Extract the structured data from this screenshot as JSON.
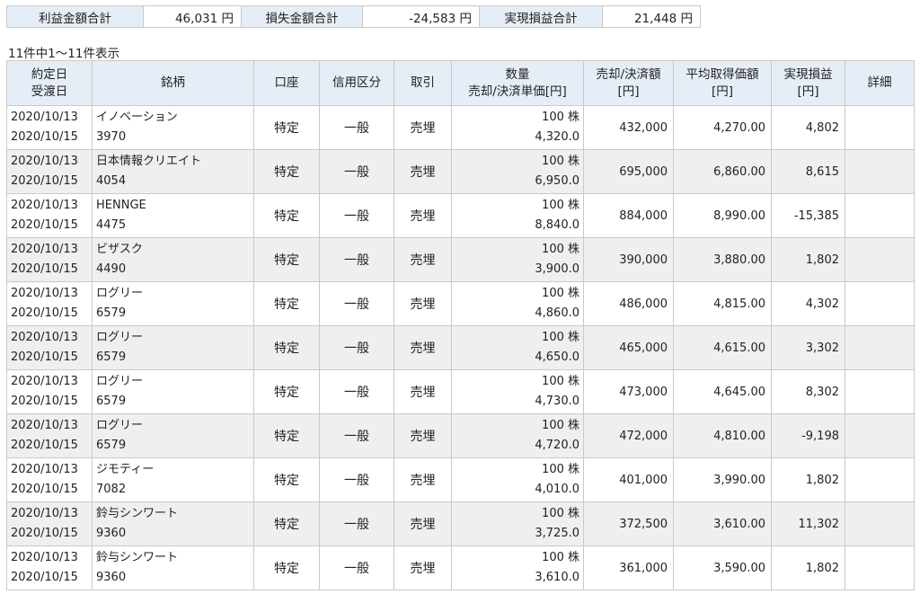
{
  "summary": {
    "profit_label": "利益金額合計",
    "profit_value": "46,031 円",
    "loss_label": "損失金額合計",
    "loss_value": "-24,583 円",
    "realized_label": "実現損益合計",
    "realized_value": "21,448 円"
  },
  "count_text": "11件中1～11件表示",
  "headers": {
    "date_1": "約定日",
    "date_2": "受渡日",
    "name": "銘柄",
    "account": "口座",
    "margin": "信用区分",
    "trade": "取引",
    "qty_1": "数量",
    "qty_2": "売却/決済単価[円]",
    "amount_1": "売却/決済額",
    "amount_2": "[円]",
    "avg_1": "平均取得価額",
    "avg_2": "[円]",
    "pl_1": "実現損益",
    "pl_2": "[円]",
    "detail": "詳細"
  },
  "rows": [
    {
      "trade_date": "2020/10/13",
      "settle_date": "2020/10/15",
      "name": "イノベーション",
      "code": "3970",
      "account": "特定",
      "margin": "一般",
      "trade": "売埋",
      "qty": "100 株",
      "unit_price": "4,320.0",
      "amount": "432,000",
      "avg_cost": "4,270.00",
      "pl": "4,802"
    },
    {
      "trade_date": "2020/10/13",
      "settle_date": "2020/10/15",
      "name": "日本情報クリエイト",
      "code": "4054",
      "account": "特定",
      "margin": "一般",
      "trade": "売埋",
      "qty": "100 株",
      "unit_price": "6,950.0",
      "amount": "695,000",
      "avg_cost": "6,860.00",
      "pl": "8,615"
    },
    {
      "trade_date": "2020/10/13",
      "settle_date": "2020/10/15",
      "name": "HENNGE",
      "code": "4475",
      "account": "特定",
      "margin": "一般",
      "trade": "売埋",
      "qty": "100 株",
      "unit_price": "8,840.0",
      "amount": "884,000",
      "avg_cost": "8,990.00",
      "pl": "-15,385"
    },
    {
      "trade_date": "2020/10/13",
      "settle_date": "2020/10/15",
      "name": "ビザスク",
      "code": "4490",
      "account": "特定",
      "margin": "一般",
      "trade": "売埋",
      "qty": "100 株",
      "unit_price": "3,900.0",
      "amount": "390,000",
      "avg_cost": "3,880.00",
      "pl": "1,802"
    },
    {
      "trade_date": "2020/10/13",
      "settle_date": "2020/10/15",
      "name": "ログリー",
      "code": "6579",
      "account": "特定",
      "margin": "一般",
      "trade": "売埋",
      "qty": "100 株",
      "unit_price": "4,860.0",
      "amount": "486,000",
      "avg_cost": "4,815.00",
      "pl": "4,302"
    },
    {
      "trade_date": "2020/10/13",
      "settle_date": "2020/10/15",
      "name": "ログリー",
      "code": "6579",
      "account": "特定",
      "margin": "一般",
      "trade": "売埋",
      "qty": "100 株",
      "unit_price": "4,650.0",
      "amount": "465,000",
      "avg_cost": "4,615.00",
      "pl": "3,302"
    },
    {
      "trade_date": "2020/10/13",
      "settle_date": "2020/10/15",
      "name": "ログリー",
      "code": "6579",
      "account": "特定",
      "margin": "一般",
      "trade": "売埋",
      "qty": "100 株",
      "unit_price": "4,730.0",
      "amount": "473,000",
      "avg_cost": "4,645.00",
      "pl": "8,302"
    },
    {
      "trade_date": "2020/10/13",
      "settle_date": "2020/10/15",
      "name": "ログリー",
      "code": "6579",
      "account": "特定",
      "margin": "一般",
      "trade": "売埋",
      "qty": "100 株",
      "unit_price": "4,720.0",
      "amount": "472,000",
      "avg_cost": "4,810.00",
      "pl": "-9,198"
    },
    {
      "trade_date": "2020/10/13",
      "settle_date": "2020/10/15",
      "name": "ジモティー",
      "code": "7082",
      "account": "特定",
      "margin": "一般",
      "trade": "売埋",
      "qty": "100 株",
      "unit_price": "4,010.0",
      "amount": "401,000",
      "avg_cost": "3,990.00",
      "pl": "1,802"
    },
    {
      "trade_date": "2020/10/13",
      "settle_date": "2020/10/15",
      "name": "鈴与シンワート",
      "code": "9360",
      "account": "特定",
      "margin": "一般",
      "trade": "売埋",
      "qty": "100 株",
      "unit_price": "3,725.0",
      "amount": "372,500",
      "avg_cost": "3,610.00",
      "pl": "11,302"
    },
    {
      "trade_date": "2020/10/13",
      "settle_date": "2020/10/15",
      "name": "鈴与シンワート",
      "code": "9360",
      "account": "特定",
      "margin": "一般",
      "trade": "売埋",
      "qty": "100 株",
      "unit_price": "3,610.0",
      "amount": "361,000",
      "avg_cost": "3,590.00",
      "pl": "1,802"
    }
  ]
}
